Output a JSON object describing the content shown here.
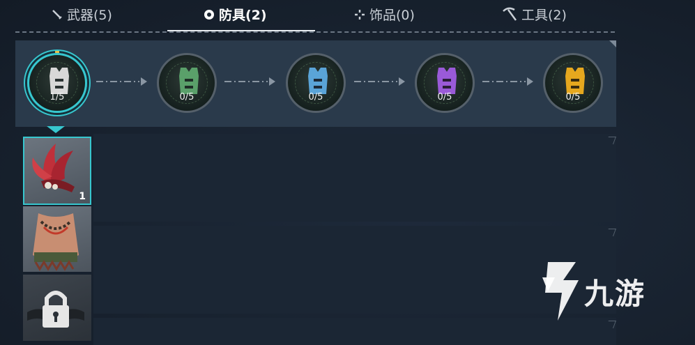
{
  "tabs": [
    {
      "label": "武器(5)",
      "icon": "sword-icon",
      "active": false
    },
    {
      "label": "防具(2)",
      "icon": "armor-gear-icon",
      "active": true
    },
    {
      "label": "饰品(0)",
      "icon": "ornament-icon",
      "active": false
    },
    {
      "label": "工具(2)",
      "icon": "pickaxe-icon",
      "active": false
    }
  ],
  "tiers": [
    {
      "count": "1/5",
      "color": "#d8d8d8",
      "selected": true
    },
    {
      "count": "0/5",
      "color": "#5aa06a",
      "selected": false
    },
    {
      "count": "0/5",
      "color": "#5aa4d8",
      "selected": false
    },
    {
      "count": "0/5",
      "color": "#9a5ad8",
      "selected": false
    },
    {
      "count": "0/5",
      "color": "#e6a81e",
      "selected": false
    }
  ],
  "items": [
    {
      "name": "red-feather-headdress",
      "quantity": "1",
      "selected": true
    },
    {
      "name": "tribal-necklace-chest-armor",
      "quantity": "",
      "selected": false
    },
    {
      "name": "locked-slot",
      "quantity": "",
      "locked": true
    }
  ],
  "watermark": {
    "text": "九游"
  },
  "colors": {
    "accent": "#37c7cf",
    "panel": "#2a3a4b"
  }
}
